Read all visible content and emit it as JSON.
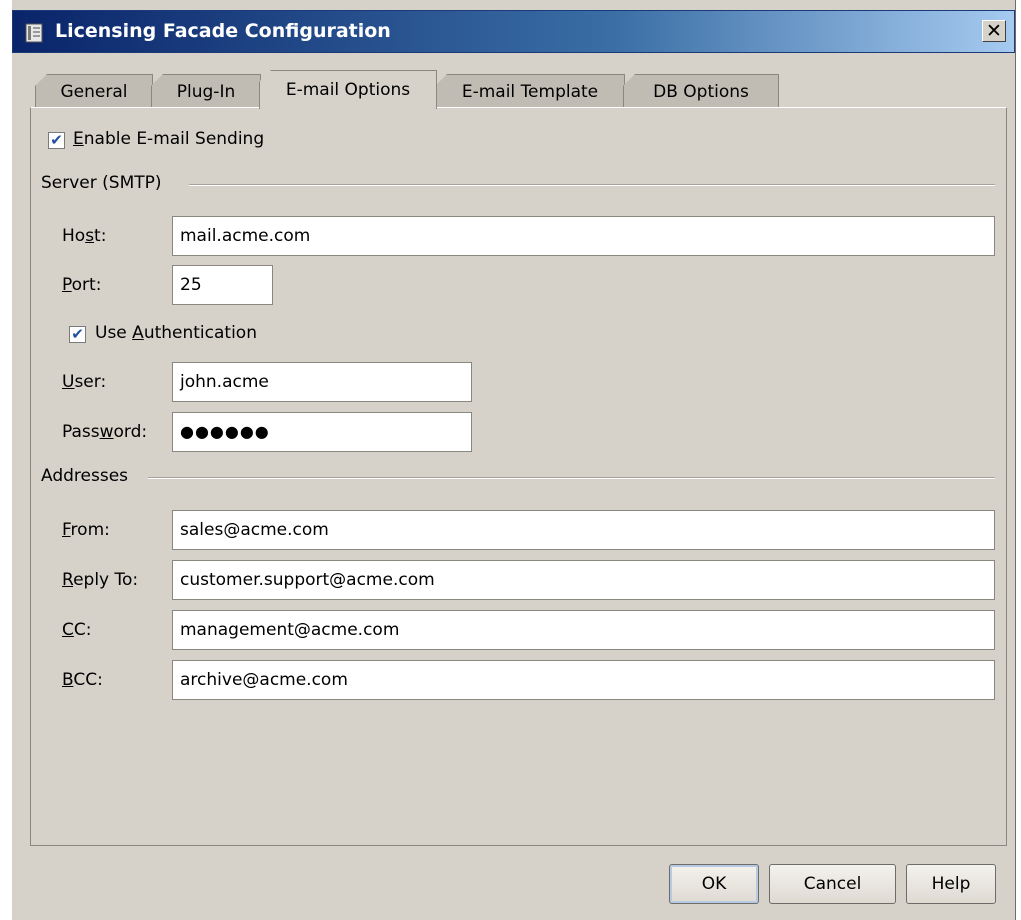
{
  "window": {
    "title": "Licensing Facade Configuration",
    "close_label": "✕",
    "icon": "app-document-icon"
  },
  "tabs": [
    {
      "label": "General",
      "active": false
    },
    {
      "label": "Plug-In",
      "active": false
    },
    {
      "label": "E-mail Options",
      "active": true
    },
    {
      "label": "E-mail Template",
      "active": false
    },
    {
      "label": "DB Options",
      "active": false
    }
  ],
  "email": {
    "enable_sending": {
      "label_mn": "E",
      "label_rest": "nable E-mail Sending",
      "checked": true
    },
    "server_section": "Server (SMTP)",
    "host": {
      "label_a": "Ho",
      "label_mn": "s",
      "label_b": "t:",
      "value": "mail.acme.com"
    },
    "port": {
      "label_mn": "P",
      "label_b": "ort:",
      "value": "25"
    },
    "use_auth": {
      "label_a": "Use ",
      "label_mn": "A",
      "label_b": "uthentication",
      "checked": true
    },
    "user": {
      "label_mn": "U",
      "label_b": "ser:",
      "value": "john.acme"
    },
    "password": {
      "label_a": "Pass",
      "label_mn": "w",
      "label_b": "ord:",
      "value": "●●●●●●"
    },
    "addresses_section": "Addresses",
    "from": {
      "label_mn": "F",
      "label_b": "rom:",
      "value": "sales@acme.com"
    },
    "reply_to": {
      "label_mn": "R",
      "label_b": "eply To:",
      "value": "customer.support@acme.com"
    },
    "cc": {
      "label_mn": "C",
      "label_b": "C:",
      "value": "management@acme.com"
    },
    "bcc": {
      "label_mn": "B",
      "label_b": "CC:",
      "value": "archive@acme.com"
    }
  },
  "buttons": {
    "ok": "OK",
    "cancel": "Cancel",
    "help": "Help"
  },
  "colors": {
    "title_gradient_start": "#0a246a",
    "title_gradient_end": "#a6caf0",
    "window_bg": "#d6d2ca",
    "check_mark": "#21519e"
  }
}
